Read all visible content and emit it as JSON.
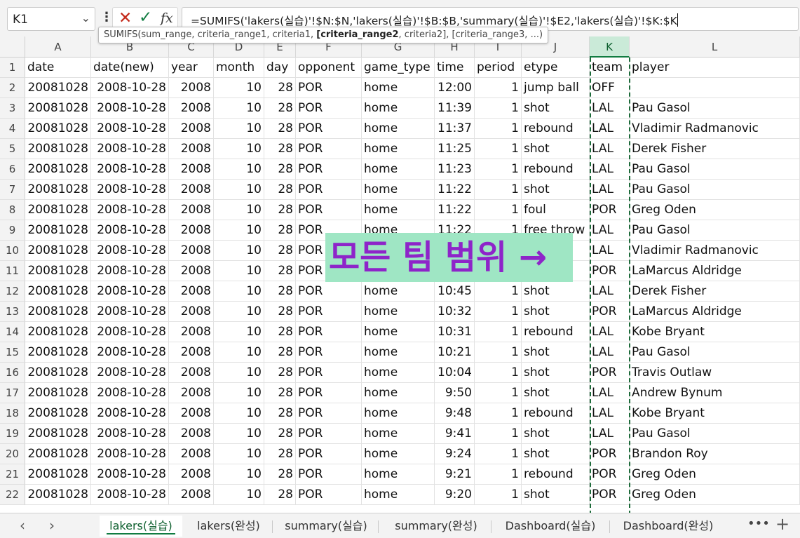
{
  "name_box": "K1",
  "formula": "=SUMIFS('lakers(실습)'!$N:$N,'lakers(실습)'!$B:$B,'summary(실습)'!$E2,'lakers(실습)'!$K:$K",
  "tooltip": {
    "fn": "SUMIFS(sum_range, criteria_range1, criteria1, ",
    "current": "[criteria_range2",
    "rest": ", criteria2], [criteria_range3, ...)"
  },
  "columns": [
    "A",
    "B",
    "C",
    "D",
    "E",
    "F",
    "G",
    "H",
    "I",
    "J",
    "K",
    "L"
  ],
  "selected_column": "K",
  "header_row": [
    "date",
    "date(new)",
    "year",
    "month",
    "day",
    "opponent",
    "game_type",
    "time",
    "period",
    "etype",
    "team",
    "player"
  ],
  "rows": [
    [
      "20081028",
      "2008-10-28",
      "2008",
      "10",
      "28",
      "POR",
      "home",
      "12:00",
      "1",
      "jump ball",
      "OFF",
      ""
    ],
    [
      "20081028",
      "2008-10-28",
      "2008",
      "10",
      "28",
      "POR",
      "home",
      "11:39",
      "1",
      "shot",
      "LAL",
      "Pau Gasol"
    ],
    [
      "20081028",
      "2008-10-28",
      "2008",
      "10",
      "28",
      "POR",
      "home",
      "11:37",
      "1",
      "rebound",
      "LAL",
      "Vladimir Radmanovic"
    ],
    [
      "20081028",
      "2008-10-28",
      "2008",
      "10",
      "28",
      "POR",
      "home",
      "11:25",
      "1",
      "shot",
      "LAL",
      "Derek Fisher"
    ],
    [
      "20081028",
      "2008-10-28",
      "2008",
      "10",
      "28",
      "POR",
      "home",
      "11:23",
      "1",
      "rebound",
      "LAL",
      "Pau Gasol"
    ],
    [
      "20081028",
      "2008-10-28",
      "2008",
      "10",
      "28",
      "POR",
      "home",
      "11:22",
      "1",
      "shot",
      "LAL",
      "Pau Gasol"
    ],
    [
      "20081028",
      "2008-10-28",
      "2008",
      "10",
      "28",
      "POR",
      "home",
      "11:22",
      "1",
      "foul",
      "POR",
      "Greg Oden"
    ],
    [
      "20081028",
      "2008-10-28",
      "2008",
      "10",
      "28",
      "POR",
      "home",
      "11:22",
      "1",
      "free throw",
      "LAL",
      "Pau Gasol"
    ],
    [
      "20081028",
      "2008-10-28",
      "2008",
      "10",
      "28",
      "POR",
      "",
      "",
      "",
      "",
      "LAL",
      "Vladimir Radmanovic"
    ],
    [
      "20081028",
      "2008-10-28",
      "2008",
      "10",
      "28",
      "POR",
      "",
      "",
      "",
      "",
      "POR",
      "LaMarcus Aldridge"
    ],
    [
      "20081028",
      "2008-10-28",
      "2008",
      "10",
      "28",
      "POR",
      "home",
      "10:45",
      "1",
      "shot",
      "LAL",
      "Derek Fisher"
    ],
    [
      "20081028",
      "2008-10-28",
      "2008",
      "10",
      "28",
      "POR",
      "home",
      "10:32",
      "1",
      "shot",
      "POR",
      "LaMarcus Aldridge"
    ],
    [
      "20081028",
      "2008-10-28",
      "2008",
      "10",
      "28",
      "POR",
      "home",
      "10:31",
      "1",
      "rebound",
      "LAL",
      "Kobe Bryant"
    ],
    [
      "20081028",
      "2008-10-28",
      "2008",
      "10",
      "28",
      "POR",
      "home",
      "10:21",
      "1",
      "shot",
      "LAL",
      "Pau Gasol"
    ],
    [
      "20081028",
      "2008-10-28",
      "2008",
      "10",
      "28",
      "POR",
      "home",
      "10:04",
      "1",
      "shot",
      "POR",
      "Travis Outlaw"
    ],
    [
      "20081028",
      "2008-10-28",
      "2008",
      "10",
      "28",
      "POR",
      "home",
      "9:50",
      "1",
      "shot",
      "LAL",
      "Andrew Bynum"
    ],
    [
      "20081028",
      "2008-10-28",
      "2008",
      "10",
      "28",
      "POR",
      "home",
      "9:48",
      "1",
      "rebound",
      "LAL",
      "Kobe Bryant"
    ],
    [
      "20081028",
      "2008-10-28",
      "2008",
      "10",
      "28",
      "POR",
      "home",
      "9:41",
      "1",
      "shot",
      "LAL",
      "Pau Gasol"
    ],
    [
      "20081028",
      "2008-10-28",
      "2008",
      "10",
      "28",
      "POR",
      "home",
      "9:24",
      "1",
      "shot",
      "POR",
      "Brandon Roy"
    ],
    [
      "20081028",
      "2008-10-28",
      "2008",
      "10",
      "28",
      "POR",
      "home",
      "9:21",
      "1",
      "rebound",
      "POR",
      "Greg Oden"
    ],
    [
      "20081028",
      "2008-10-28",
      "2008",
      "10",
      "28",
      "POR",
      "home",
      "9:20",
      "1",
      "shot",
      "POR",
      "Greg Oden"
    ]
  ],
  "overlay_text": "모든 팀 범위 →",
  "sheet_tabs": [
    "lakers(실습)",
    "lakers(완성)",
    "summary(실습)",
    "summary(완성)",
    "Dashboard(실습)",
    "Dashboard(완성)"
  ],
  "active_tab_index": 0,
  "colors": {
    "accent": "#107c41",
    "overlay_bg": "#9fe6c4",
    "overlay_text": "#8e24c9",
    "cancel": "#c42b1c"
  }
}
